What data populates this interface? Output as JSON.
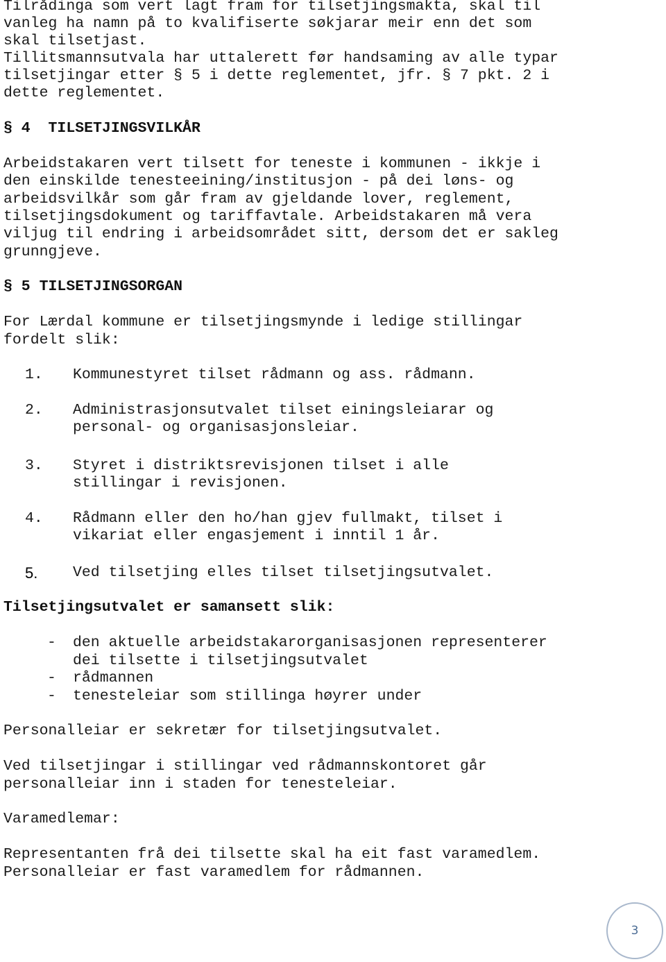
{
  "intro": {
    "lines": [
      "Tilrådinga som vert lagt fram for tilsetjingsmakta, skal til",
      "vanleg ha namn på to kvalifiserte søkjarar meir enn det som",
      "skal tilsetjast.",
      "Tillitsmannsutvala har uttalerett før handsaming av alle typar",
      "tilsetjingar etter § 5 i dette reglementet, jfr. § 7 pkt. 2 i",
      "dette reglementet."
    ]
  },
  "section4": {
    "heading": "§ 4  TILSETJINGSVILKÅR",
    "body": [
      "Arbeidstakaren vert tilsett for teneste i kommunen - ikkje i",
      "den einskilde tenesteeining/institusjon - på dei løns- og",
      "arbeidsvilkår som går fram av gjeldande lover, reglement,",
      "tilsetjingsdokument og tariffavtale. Arbeidstakaren må vera",
      "viljug til endring i arbeidsområdet sitt, dersom det er sakleg",
      "grunngjeve."
    ]
  },
  "section5": {
    "heading": "§ 5 TILSETJINGSORGAN",
    "intro": [
      "For Lærdal kommune er tilsetjingsmynde i ledige stillingar",
      "fordelt slik:"
    ],
    "items": [
      {
        "num": "1.",
        "lines": [
          "Kommunestyret tilset rådmann og ass. rådmann."
        ]
      },
      {
        "num": "2.",
        "lines": [
          "Administrasjonsutvalet tilset einingsleiarar og",
          "personal- og organisasjonsleiar."
        ]
      },
      {
        "num": "3.",
        "lines": [
          "Styret i distriktsrevisjonen tilset i alle",
          "stillingar i revisjonen."
        ]
      },
      {
        "num": "4.",
        "lines": [
          "Rådmann eller den ho/han gjev fullmakt, tilset i",
          "vikariat eller engasjement i inntil 1 år."
        ]
      },
      {
        "num": "5.",
        "lines": [
          "Ved tilsetjing elles tilset tilsetjingsutvalet."
        ]
      }
    ]
  },
  "committee": {
    "heading": "Tilsetjingsutvalet er samansett slik:",
    "members": [
      {
        "dash": "-",
        "lines": [
          "den aktuelle arbeidstakarorganisasjonen representerer",
          "dei tilsette i tilsetjingsutvalet"
        ]
      },
      {
        "dash": "-",
        "lines": [
          "rådmannen"
        ]
      },
      {
        "dash": "-",
        "lines": [
          "tenesteleiar som stillinga høyrer under"
        ]
      }
    ],
    "secretary": "Personalleiar er sekretær for tilsetjingsutvalet.",
    "office_note": [
      "Ved tilsetjingar i stillingar ved rådmannskontoret går",
      "personalleiar inn i staden for tenesteleiar."
    ],
    "deputies_label": "Varamedlemar:",
    "deputies": [
      "Representanten frå dei tilsette skal ha eit fast varamedlem.",
      "Personalleiar er fast varamedlem for rådmannen."
    ]
  },
  "footer": {
    "page_number": "3",
    "circle_color": "#a9b8cc",
    "number_color": "#4a6b94"
  }
}
